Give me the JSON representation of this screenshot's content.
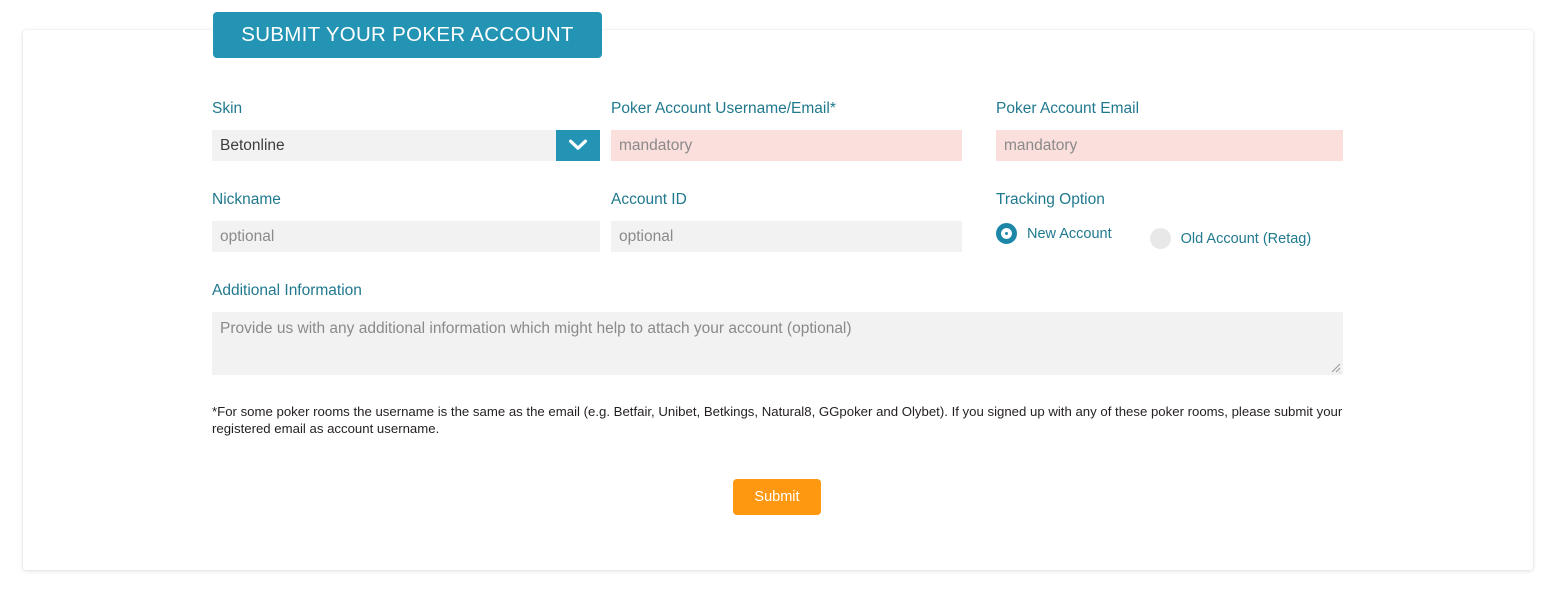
{
  "header": {
    "tab_title": "SUBMIT YOUR POKER ACCOUNT"
  },
  "colors": {
    "accent_teal": "#2494b5",
    "label_teal": "#21798e",
    "submit_orange": "#ff9811",
    "mandatory_pink": "#fbdfdd",
    "optional_gray": "#f2f2f2"
  },
  "form": {
    "fields": {
      "skin": {
        "label": "Skin",
        "value": "Betonline",
        "icon": "chevron-down-icon"
      },
      "username_email": {
        "label": "Poker Account Username/Email*",
        "placeholder": "mandatory",
        "value": ""
      },
      "account_email": {
        "label": "Poker Account Email",
        "placeholder": "mandatory",
        "value": ""
      },
      "nickname": {
        "label": "Nickname",
        "placeholder": "optional",
        "value": ""
      },
      "account_id": {
        "label": "Account ID",
        "placeholder": "optional",
        "value": ""
      },
      "tracking_option": {
        "label": "Tracking Option",
        "options": [
          {
            "label": "New Account",
            "selected": true
          },
          {
            "label": "Old Account (Retag)",
            "selected": false
          }
        ]
      },
      "additional_information": {
        "label": "Additional Information",
        "placeholder": "Provide us with any additional information which might help to attach your account (optional)",
        "value": ""
      }
    },
    "footnote": "*For some poker rooms the username is the same as the email (e.g. Betfair, Unibet, Betkings, Natural8, GGpoker and Olybet). If you signed up with any of these poker rooms, please submit your registered email as account username.",
    "submit_label": "Submit"
  }
}
